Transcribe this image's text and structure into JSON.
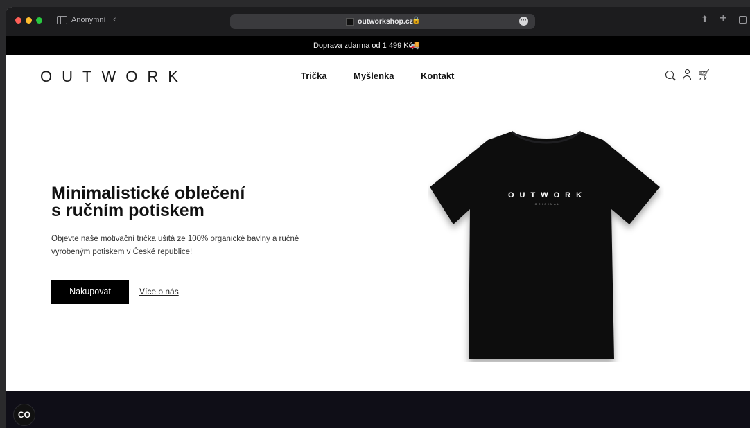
{
  "browser": {
    "profile_label": "Anonymní",
    "url": "outworkshop.cz",
    "icons": [
      "sidebar-icon",
      "back-icon",
      "lock-icon",
      "more-icon",
      "share-icon",
      "plus-icon",
      "tabs-icon"
    ]
  },
  "banner": {
    "text": "Doprava zdarma od 1 499 Kč",
    "icon": "truck-icon"
  },
  "header": {
    "logo": "OUTWORK",
    "nav": [
      "Trička",
      "Myšlenka",
      "Kontakt"
    ],
    "icons": [
      "search-icon",
      "user-icon",
      "cart-icon"
    ]
  },
  "hero": {
    "title_line1": "Minimalistické oblečení",
    "title_line2": "s ručním potiskem",
    "description_line1": "Objevte naše motivační trička ušitá ze 100% organické bavlny a ručně",
    "description_line2": "vyrobeným potiskem v České republice!",
    "shop_button": "Nakupovat",
    "about_link": "Více o nás",
    "tshirt_print": "OUTWORK",
    "tshirt_print_sub": "ORIGINAL"
  },
  "cookie_button": "CO",
  "colors": {
    "banner_bg": "#000000",
    "button_bg": "#000000",
    "dark_strip": "#0f0e17"
  }
}
